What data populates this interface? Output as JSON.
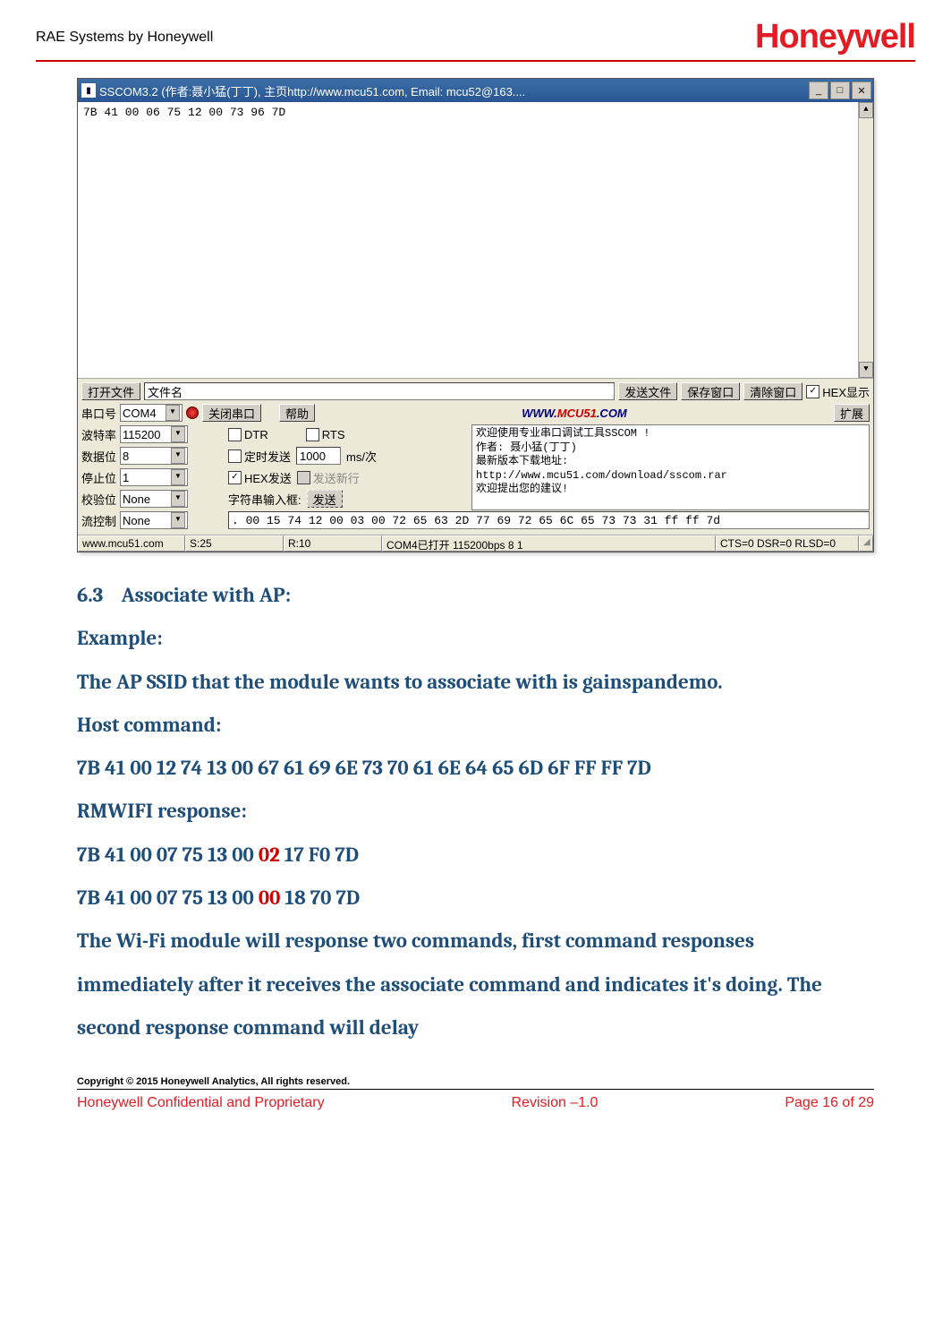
{
  "header": {
    "left": "RAE Systems by Honeywell",
    "logo": "Honeywell"
  },
  "app": {
    "title": "SSCOM3.2 (作者:聂小猛(丁丁), 主页http://www.mcu51.com,  Email: mcu52@163....",
    "output_text": "7B 41 00 06 75 12 00 73 96 7D",
    "row1": {
      "open_file": "打开文件",
      "filename_placeholder": "文件名",
      "send_file": "发送文件",
      "save_window": "保存窗口",
      "clear_window": "清除窗口",
      "hex_display": "HEX显示"
    },
    "row2": {
      "port_label": "串口号",
      "port_value": "COM4",
      "close_port": "关闭串口",
      "help": "帮助",
      "link_prefix": "WWW.",
      "link_mid": "MCU51",
      "link_suffix": ".COM",
      "expand": "扩展"
    },
    "settings": {
      "baud_label": "波特率",
      "baud_value": "115200",
      "data_label": "数据位",
      "data_value": "8",
      "stop_label": "停止位",
      "stop_value": "1",
      "parity_label": "校验位",
      "parity_value": "None",
      "flow_label": "流控制",
      "flow_value": "None",
      "dtr": "DTR",
      "rts": "RTS",
      "timer_send": "定时发送",
      "interval_value": "1000",
      "interval_unit": "ms/次",
      "hex_send": "HEX发送",
      "send_newline": "发送新行",
      "input_label": "字符串输入框:",
      "send_btn": "发送",
      "info_text": "欢迎使用专业串口调试工具SSCOM !\n作者: 聂小猛(丁丁)\n最新版本下载地址:\nhttp://www.mcu51.com/download/sscom.rar\n欢迎提出您的建议!",
      "bottom_hex": ". 00 15 74 12 00 03 00 72 65 63 2D 77 69 72 65 6C 65 73 73 31 ff ff 7d"
    },
    "status": {
      "url": "www.mcu51.com",
      "s": "S:25",
      "r": "R:10",
      "port_status": "COM4已打开 115200bps 8 1",
      "ctrl": "CTS=0 DSR=0 RLSD=0"
    }
  },
  "doc": {
    "sec_num": "6.3",
    "sec_title": "Associate with AP:",
    "example": "Example:",
    "line1": "The AP SSID that the module wants to associate with is gainspandemo.",
    "host_cmd": "Host command:",
    "host_hex": " 7B 41 00 12 74 13 00 67 61 69 6E 73 70 61 6E 64 65 6D 6F FF FF 7D",
    "resp_label": "RMWIFI response:",
    "resp1_a": "7B 41 00 07 75 13 00 ",
    "resp1_red": "02",
    "resp1_b": " 17 F0 7D",
    "resp2_a": "7B 41 00 07 75 13 00 ",
    "resp2_red": "00",
    "resp2_b": " 18 70 7D",
    "para": "The Wi-Fi module will response two commands, first command responses immediately after it receives the associate command and indicates it's doing. The second response command will delay"
  },
  "footer": {
    "copyright": "Copyright © 2015 Honeywell Analytics, All rights reserved.",
    "left": "Honeywell Confidential and Proprietary",
    "center": "Revision –1.0",
    "right": "Page 16 of 29"
  }
}
